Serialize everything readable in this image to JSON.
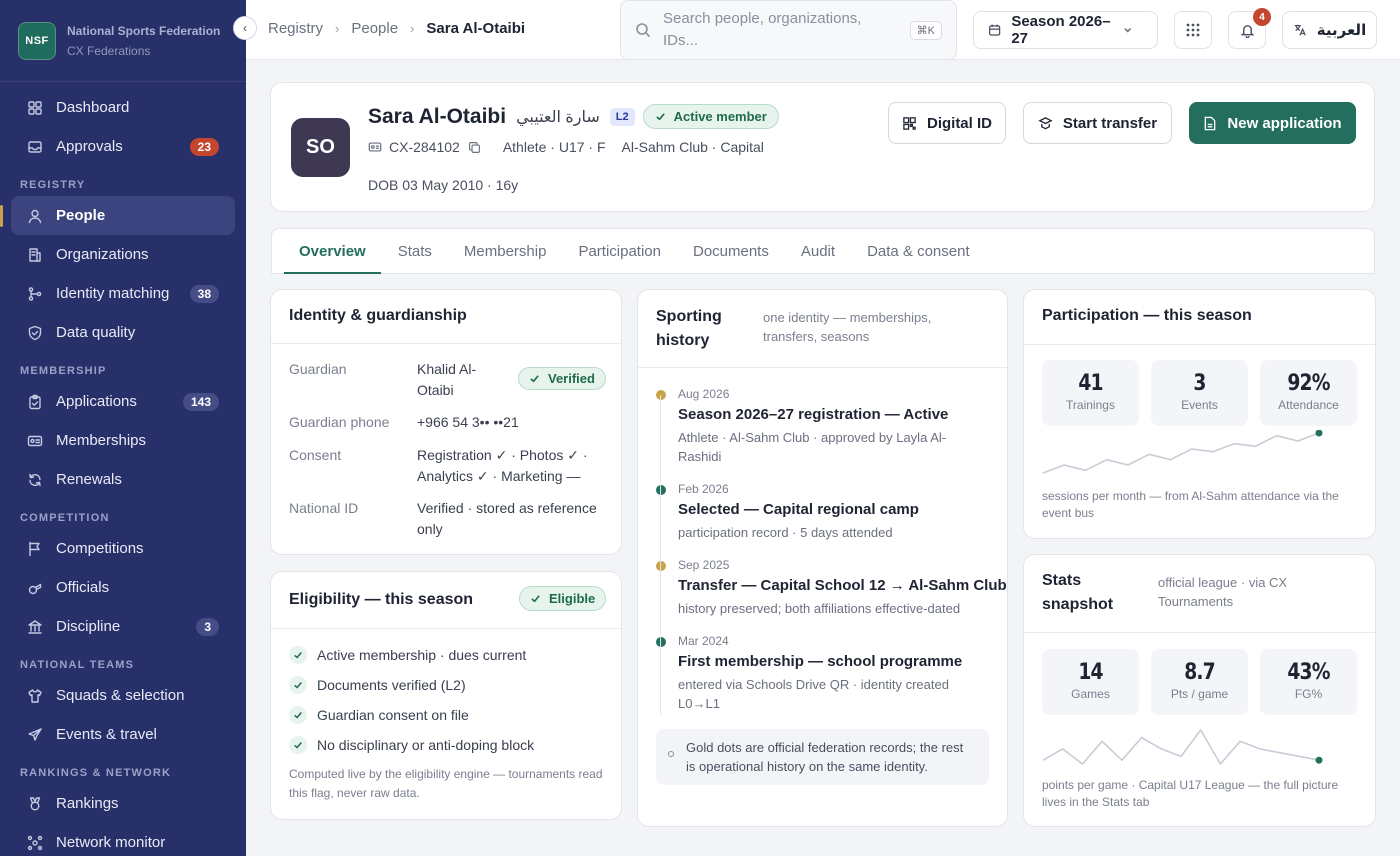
{
  "brand": {
    "logo": "NSF",
    "name": "National Sports Federation",
    "sub": "CX Federations"
  },
  "nav": {
    "top": [
      {
        "label": "Dashboard",
        "icon": "grid-icon"
      },
      {
        "label": "Approvals",
        "icon": "inbox-icon",
        "badge": "23"
      }
    ],
    "sections": [
      {
        "title": "REGISTRY",
        "items": [
          {
            "label": "People",
            "icon": "person-icon",
            "active": true
          },
          {
            "label": "Organizations",
            "icon": "building-icon"
          },
          {
            "label": "Identity matching",
            "icon": "branch-icon",
            "badge": "38"
          },
          {
            "label": "Data quality",
            "icon": "shield-check-icon"
          }
        ]
      },
      {
        "title": "MEMBERSHIP",
        "items": [
          {
            "label": "Applications",
            "icon": "clipboard-icon",
            "badge": "143"
          },
          {
            "label": "Memberships",
            "icon": "id-card-icon"
          },
          {
            "label": "Renewals",
            "icon": "refresh-icon"
          }
        ]
      },
      {
        "title": "COMPETITION",
        "items": [
          {
            "label": "Competitions",
            "icon": "flag-icon"
          },
          {
            "label": "Officials",
            "icon": "whistle-icon"
          },
          {
            "label": "Discipline",
            "icon": "bank-icon",
            "badge": "3"
          }
        ]
      },
      {
        "title": "NATIONAL TEAMS",
        "items": [
          {
            "label": "Squads & selection",
            "icon": "shirt-icon"
          },
          {
            "label": "Events & travel",
            "icon": "plane-icon"
          }
        ]
      },
      {
        "title": "RANKINGS & NETWORK",
        "items": [
          {
            "label": "Rankings",
            "icon": "medal-icon"
          },
          {
            "label": "Network monitor",
            "icon": "network-icon"
          }
        ]
      }
    ]
  },
  "topbar": {
    "breadcrumbs": [
      "Registry",
      "People",
      "Sara Al-Otaibi"
    ],
    "search_placeholder": "Search people, organizations, IDs...",
    "search_shortcut": "⌘K",
    "season": "Season 2026–27",
    "notifications": "4",
    "language": "العربية"
  },
  "profile": {
    "initials": "SO",
    "name": "Sara Al-Otaibi",
    "name_ar": "سارة العتيبي",
    "level": "L2",
    "status": "Active member",
    "id": "CX-284102",
    "role": "Athlete · U17 · F",
    "club": "Al-Sahm Club · Capital",
    "dob": "DOB 03 May 2010 · 16y",
    "actions": {
      "digital_id": "Digital ID",
      "transfer": "Start transfer",
      "new_app": "New application"
    }
  },
  "tabs": [
    "Overview",
    "Stats",
    "Membership",
    "Participation",
    "Documents",
    "Audit",
    "Data & consent"
  ],
  "identity": {
    "title": "Identity & guardianship",
    "verified": "Verified",
    "rows": [
      {
        "label": "Guardian",
        "value": "Khalid Al-Otaibi"
      },
      {
        "label": "Guardian phone",
        "value": "+966 54 3•• ••21"
      },
      {
        "label": "Consent",
        "value": "Registration ✓ · Photos ✓ · Analytics ✓ · Marketing —"
      },
      {
        "label": "National ID",
        "value": "Verified · stored as reference only"
      }
    ]
  },
  "eligibility": {
    "title": "Eligibility — this season",
    "status": "Eligible",
    "checks": [
      "Active membership · dues current",
      "Documents verified (L2)",
      "Guardian consent on file",
      "No disciplinary or anti-doping block"
    ],
    "note": "Computed live by the eligibility engine — tournaments read this flag, never raw data."
  },
  "history": {
    "title": "Sporting history",
    "subtitle": "one identity — memberships, transfers, seasons",
    "items": [
      {
        "date": "Aug 2026",
        "title": "Season 2026–27 registration — Active",
        "desc": "Athlete · Al-Sahm Club · approved by Layla Al-Rashidi",
        "official": true
      },
      {
        "date": "Feb 2026",
        "title": "Selected — Capital regional camp",
        "desc": "participation record · 5 days attended",
        "official": false
      },
      {
        "date": "Sep 2025",
        "title": "Transfer — Capital School 12 → Al-Sahm Club",
        "desc": "history preserved; both affiliations effective-dated",
        "official": true
      },
      {
        "date": "Mar 2024",
        "title": "First membership — school programme",
        "desc": "entered via Schools Drive QR · identity created L0→L1",
        "official": false
      }
    ],
    "note": "Gold dots are official federation records; the rest is operational history on the same identity."
  },
  "participation": {
    "title": "Participation — this season",
    "stats": [
      {
        "value": "41",
        "label": "Trainings"
      },
      {
        "value": "3",
        "label": "Events"
      },
      {
        "value": "92%",
        "label": "Attendance"
      }
    ],
    "spark": [
      2,
      5,
      3,
      7,
      5,
      9,
      7,
      11,
      10,
      13,
      12,
      16,
      14,
      17
    ],
    "caption": "sessions per month — from Al-Sahm attendance via the event bus"
  },
  "stats": {
    "title": "Stats snapshot",
    "subtitle": "official league · via CX Tournaments",
    "stats": [
      {
        "value": "14",
        "label": "Games"
      },
      {
        "value": "8.7",
        "label": "Pts / game"
      },
      {
        "value": "43%",
        "label": "FG%"
      }
    ],
    "spark": [
      6,
      9,
      5,
      11,
      6,
      12,
      9,
      7,
      14,
      5,
      11,
      9,
      8,
      7,
      6
    ],
    "caption": "points per game · Capital U17 League — the full picture lives in the Stats tab"
  },
  "colors": {
    "accent": "#236e5c",
    "sidebar": "#28306a",
    "gold": "#c9a14a",
    "danger": "#c4462e"
  }
}
